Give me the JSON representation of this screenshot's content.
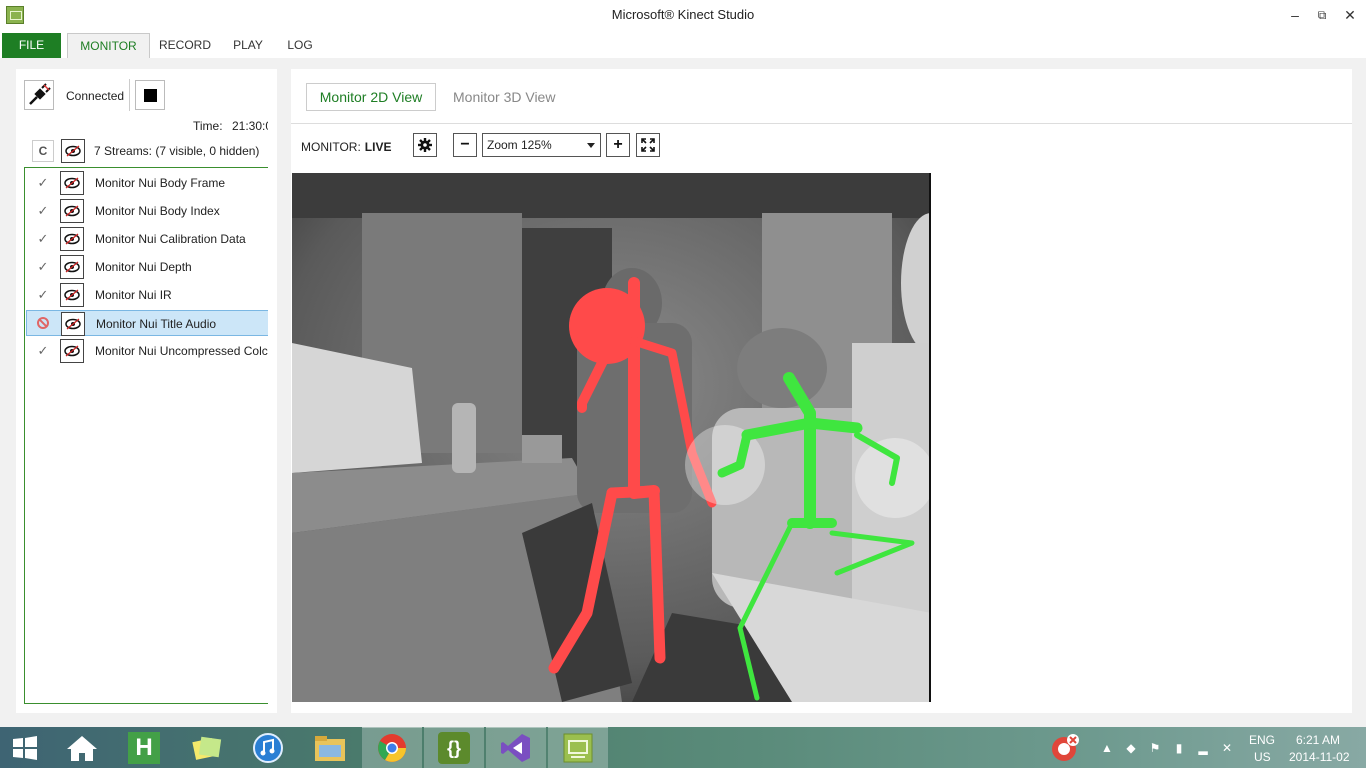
{
  "window": {
    "title": "Microsoft® Kinect Studio",
    "minimize": "–",
    "maximize": "⧉",
    "close": "✕"
  },
  "menu": {
    "file": "FILE",
    "tabs": [
      "MONITOR",
      "RECORD",
      "PLAY",
      "LOG"
    ]
  },
  "connection": {
    "status": "Connected",
    "time_label": "Time:",
    "time_value": "21:30:0"
  },
  "streams": {
    "summary_button": "C",
    "summary": "7 Streams: (7 visible, 0 hidden)",
    "items": [
      {
        "name": "Monitor Nui Body Frame",
        "enabled": true
      },
      {
        "name": "Monitor Nui Body Index",
        "enabled": true
      },
      {
        "name": "Monitor Nui Calibration Data",
        "enabled": true
      },
      {
        "name": "Monitor Nui Depth",
        "enabled": true
      },
      {
        "name": "Monitor Nui IR",
        "enabled": true
      },
      {
        "name": "Monitor Nui Title Audio",
        "enabled": false,
        "selected": true
      },
      {
        "name": "Monitor Nui Uncompressed Colc",
        "enabled": true
      }
    ]
  },
  "view": {
    "tab_2d": "Monitor 2D View",
    "tab_3d": "Monitor 3D View",
    "monitor_label": "MONITOR:",
    "monitor_state": "LIVE",
    "zoom": "Zoom 125%",
    "zoom_out": "−",
    "zoom_in": "+"
  },
  "skeletons": {
    "body1_color": "#ff4a4a",
    "body2_color": "#3fe63f"
  },
  "taskbar": {
    "apps": [
      "windows-start-icon",
      "home-icon",
      "h-app-icon",
      "sticky-notes-icon",
      "itunes-icon",
      "file-explorer-icon",
      "chrome-icon",
      "brackets-icon",
      "visual-studio-icon",
      "kinect-studio-icon"
    ],
    "brackets_glyph": "{}",
    "h_glyph": "H",
    "language": "ENG",
    "region": "US",
    "time": "6:21 AM",
    "date": "2014-11-02"
  }
}
